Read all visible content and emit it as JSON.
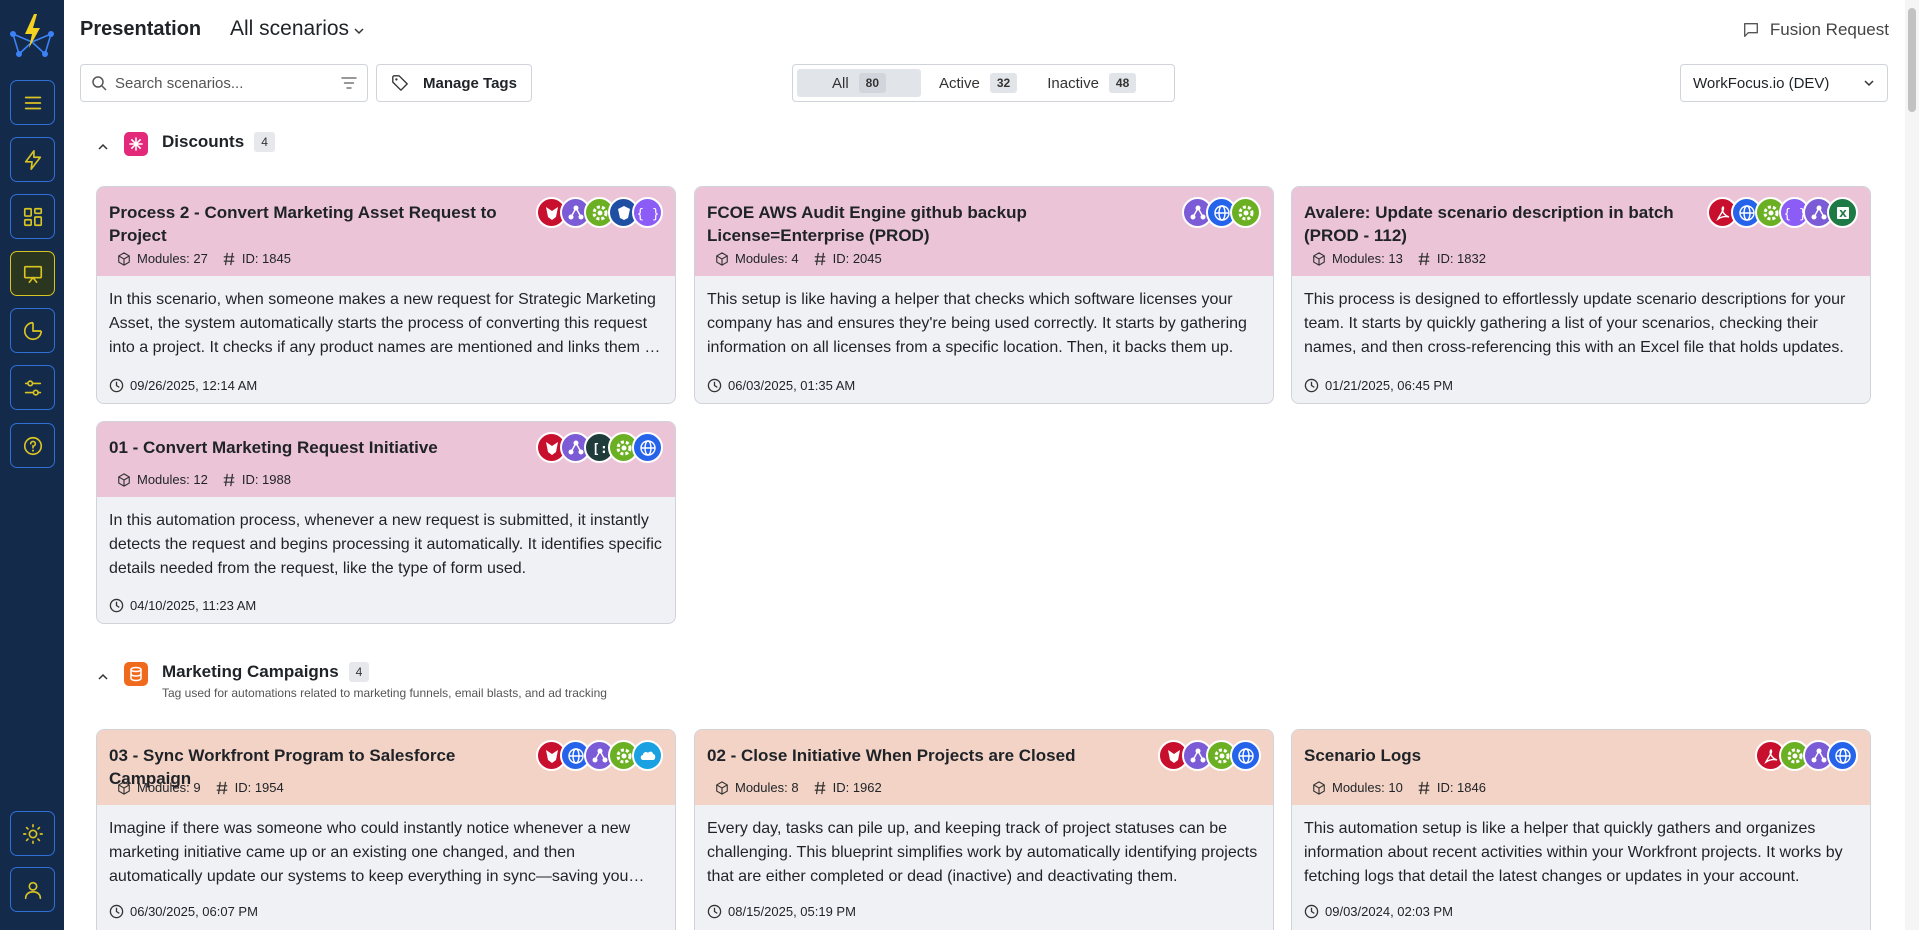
{
  "header": {
    "title": "Presentation",
    "scenario_filter": "All scenarios",
    "fusion_request": "Fusion Request"
  },
  "toolbar": {
    "search_placeholder": "Search scenarios...",
    "manage_tags": "Manage Tags",
    "segments": [
      {
        "label": "All",
        "count": "80"
      },
      {
        "label": "Active",
        "count": "32"
      },
      {
        "label": "Inactive",
        "count": "48"
      }
    ],
    "org": "WorkFocus.io (DEV)"
  },
  "groups": [
    {
      "name": "Discounts",
      "count": "4",
      "icon": "sparkle-icon",
      "color": "#e2297a",
      "cards": [
        {
          "title": "Process 2 - Convert Marketing Asset Request to Project",
          "modules": "Modules: 27",
          "id": "ID: 1845",
          "desc": "In this scenario, when someone makes a new request for Strategic Marketing Asset, the system automatically starts the process of converting this request into a project. It checks if any product names are mentioned and links them to the project.",
          "date": "09/26/2025, 12:14 AM",
          "apps": [
            "workfront-icon",
            "flow-icon",
            "gear-icon",
            "brave-icon",
            "json-icon"
          ]
        },
        {
          "title": "FCOE AWS Audit Engine github backup License=Enterprise (PROD)",
          "modules": "Modules: 4",
          "id": "ID: 2045",
          "desc": "This setup is like having a helper that checks which software licenses your company has and ensures they're being used correctly. It starts by gathering information on all licenses from a specific location. Then, it backs them up.",
          "date": "06/03/2025, 01:35 AM",
          "apps": [
            "flow-icon",
            "globe-icon",
            "gear-icon"
          ]
        },
        {
          "title": "Avalere: Update scenario description in batch (PROD - 112)",
          "modules": "Modules: 13",
          "id": "ID: 1832",
          "desc": "This process is designed to effortlessly update scenario descriptions for your team. It starts by quickly gathering a list of your scenarios, checking their names, and then cross-referencing this with an Excel file that holds updates.",
          "date": "01/21/2025, 06:45 PM",
          "apps": [
            "acrobat-icon",
            "globe-icon",
            "gear-icon",
            "json-icon",
            "flow-icon",
            "excel-icon"
          ]
        },
        {
          "title": "01 - Convert Marketing Request Initiative",
          "modules": "Modules: 12",
          "id": "ID: 1988",
          "desc": "In this automation process, whenever a new request is submitted, it instantly detects the request and begins processing it automatically. It identifies specific details needed from the request, like the type of form used.",
          "date": "04/10/2025, 11:23 AM",
          "apps": [
            "workfront-icon",
            "flow-icon",
            "parser-icon",
            "gear-icon",
            "globe-icon"
          ]
        }
      ]
    },
    {
      "name": "Marketing Campaigns",
      "count": "4",
      "desc": "Tag used for automations related to marketing funnels, email blasts, and ad tracking",
      "icon": "database-icon",
      "color": "#f06a1e",
      "cards": [
        {
          "title": "03 - Sync Workfront Program to Salesforce Campaign",
          "modules": "Modules: 9",
          "id": "ID: 1954",
          "desc": "Imagine if there was someone who could instantly notice whenever a new marketing initiative came up or an existing one changed, and then automatically update our systems to keep everything in sync—saving you time.",
          "date": "06/30/2025, 06:07 PM",
          "apps": [
            "workfront-icon",
            "globe-icon",
            "flow-icon",
            "gear-icon",
            "salesforce-icon"
          ]
        },
        {
          "title": "02 - Close Initiative When Projects are Closed",
          "modules": "Modules: 8",
          "id": "ID: 1962",
          "desc": "Every day, tasks can pile up, and keeping track of project statuses can be challenging. This blueprint simplifies work by automatically identifying projects that are either completed or dead (inactive) and deactivating them.",
          "date": "08/15/2025, 05:19 PM",
          "apps": [
            "workfront-icon",
            "flow-icon",
            "gear-icon",
            "globe-icon"
          ]
        },
        {
          "title": "Scenario Logs",
          "modules": "Modules: 10",
          "id": "ID: 1846",
          "desc": "This automation setup is like a helper that quickly gathers and organizes information about recent activities within your Workfront projects. It works by fetching logs that detail the latest changes or updates in your account.",
          "date": "09/03/2024, 02:03 PM",
          "apps": [
            "acrobat-icon",
            "gear-icon",
            "flow-icon",
            "globe-icon"
          ]
        }
      ]
    }
  ]
}
